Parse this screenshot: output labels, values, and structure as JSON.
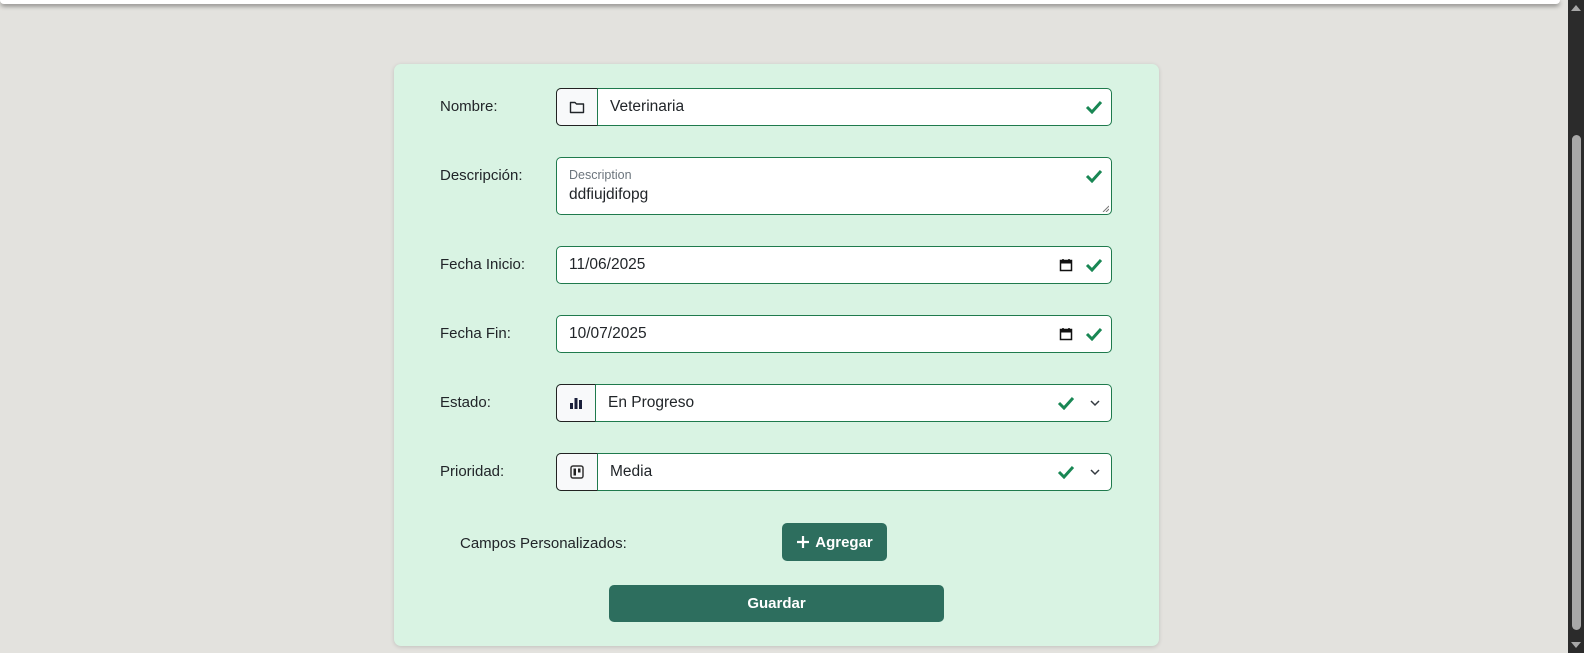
{
  "form": {
    "nombre": {
      "label": "Nombre:",
      "value": "Veterinaria"
    },
    "descripcion": {
      "label": "Descripción:",
      "placeholder": "Description",
      "value": "ddfiujdifopg"
    },
    "fecha_inicio": {
      "label": "Fecha Inicio:",
      "value": "11/06/2025"
    },
    "fecha_fin": {
      "label": "Fecha Fin:",
      "value": "10/07/2025"
    },
    "estado": {
      "label": "Estado:",
      "value": "En Progreso"
    },
    "prioridad": {
      "label": "Prioridad:",
      "value": "Media"
    },
    "custom_fields_label": "Campos Personalizados:",
    "add_button": "Agregar",
    "save_button": "Guardar"
  },
  "colors": {
    "accent": "#2d6e5e",
    "valid": "#198754",
    "card": "#d9f3e3"
  }
}
